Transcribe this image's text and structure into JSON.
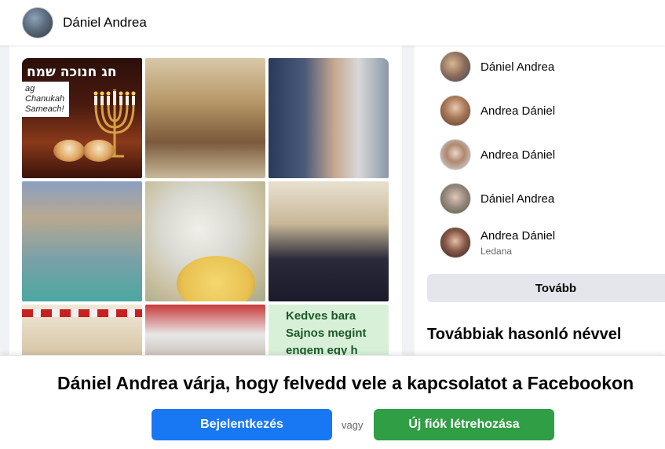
{
  "header": {
    "profile_name": "Dániel Andrea"
  },
  "photos": {
    "chanukah": {
      "hebrew_text": "חג חנוכה שמח",
      "english_text": "ag Chanukah Sameach!"
    },
    "sign_text": [
      "Kedves bara",
      "Sajnos megint",
      "engem egy h"
    ]
  },
  "people": [
    {
      "name": "Dániel Andrea",
      "sub": ""
    },
    {
      "name": "Andrea Dániel",
      "sub": ""
    },
    {
      "name": "Andrea Dániel",
      "sub": ""
    },
    {
      "name": "Dániel Andrea",
      "sub": ""
    },
    {
      "name": "Andrea Dániel",
      "sub": "Ledana"
    }
  ],
  "more_button": "Tovább",
  "similar_section_title": "Továbbiak hasonló névvel",
  "prompt": {
    "headline": "Dániel Andrea várja, hogy felvedd vele a kapcsolatot a Facebookon",
    "login_label": "Bejelentkezés",
    "or_label": "vagy",
    "signup_label": "Új fiók létrehozása"
  },
  "colors": {
    "primary_blue": "#1877f2",
    "signup_green": "#2f9e44",
    "button_gray": "#e4e6eb"
  }
}
